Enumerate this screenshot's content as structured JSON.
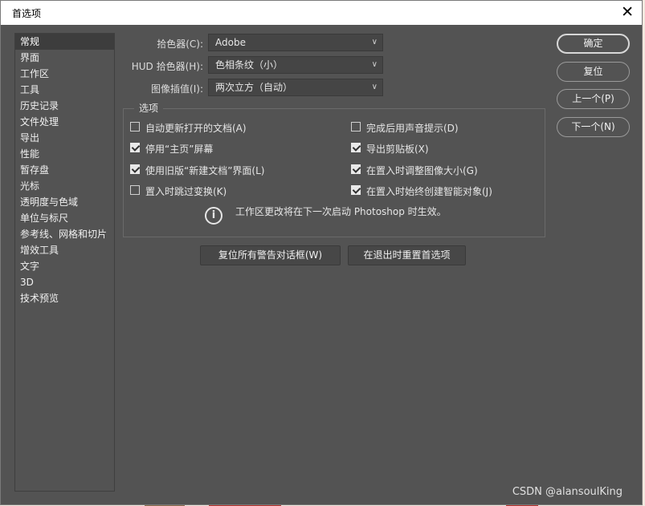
{
  "window": {
    "title": "首选项",
    "close_glyph": "✕"
  },
  "sidebar": {
    "items": [
      {
        "label": "常规",
        "selected": true
      },
      {
        "label": "界面"
      },
      {
        "label": "工作区"
      },
      {
        "label": "工具"
      },
      {
        "label": "历史记录"
      },
      {
        "label": "文件处理"
      },
      {
        "label": "导出"
      },
      {
        "label": "性能"
      },
      {
        "label": "暂存盘"
      },
      {
        "label": "光标"
      },
      {
        "label": "透明度与色域"
      },
      {
        "label": "单位与标尺"
      },
      {
        "label": "参考线、网格和切片"
      },
      {
        "label": "增效工具"
      },
      {
        "label": "文字"
      },
      {
        "label": "3D"
      },
      {
        "label": "技术预览"
      }
    ]
  },
  "general": {
    "color_picker": {
      "label": "拾色器(C):",
      "value": "Adobe"
    },
    "hud_color_picker": {
      "label": "HUD 拾色器(H):",
      "value": "色相条纹（小）"
    },
    "image_interpolation": {
      "label": "图像插值(I):",
      "value": "两次立方（自动）"
    }
  },
  "options": {
    "title": "选项",
    "checkboxes": [
      {
        "label": "自动更新打开的文档(A)",
        "checked": false
      },
      {
        "label": "完成后用声音提示(D)",
        "checked": false
      },
      {
        "label": "停用“主页”屏幕",
        "checked": true
      },
      {
        "label": "导出剪贴板(X)",
        "checked": true
      },
      {
        "label": "使用旧版“新建文档”界面(L)",
        "checked": true
      },
      {
        "label": "在置入时调整图像大小(G)",
        "checked": true
      },
      {
        "label": "置入时跳过变换(K)",
        "checked": false
      },
      {
        "label": "在置入时始终创建智能对象(J)",
        "checked": true
      }
    ],
    "info_text": "工作区更改将在下一次启动 Photoshop 时生效。",
    "info_icon": "info-icon"
  },
  "buttons": {
    "ok": "确定",
    "reset": "复位",
    "prev": "上一个(P)",
    "next": "下一个(N)",
    "reset_warnings": "复位所有警告对话框(W)",
    "reset_on_quit": "在退出时重置首选项"
  },
  "watermark": "CSDN @alansoulKing",
  "colors": {
    "panel": "#535353",
    "sidebar_selected": "#3d3d3d",
    "text": "#e6e6e6"
  }
}
